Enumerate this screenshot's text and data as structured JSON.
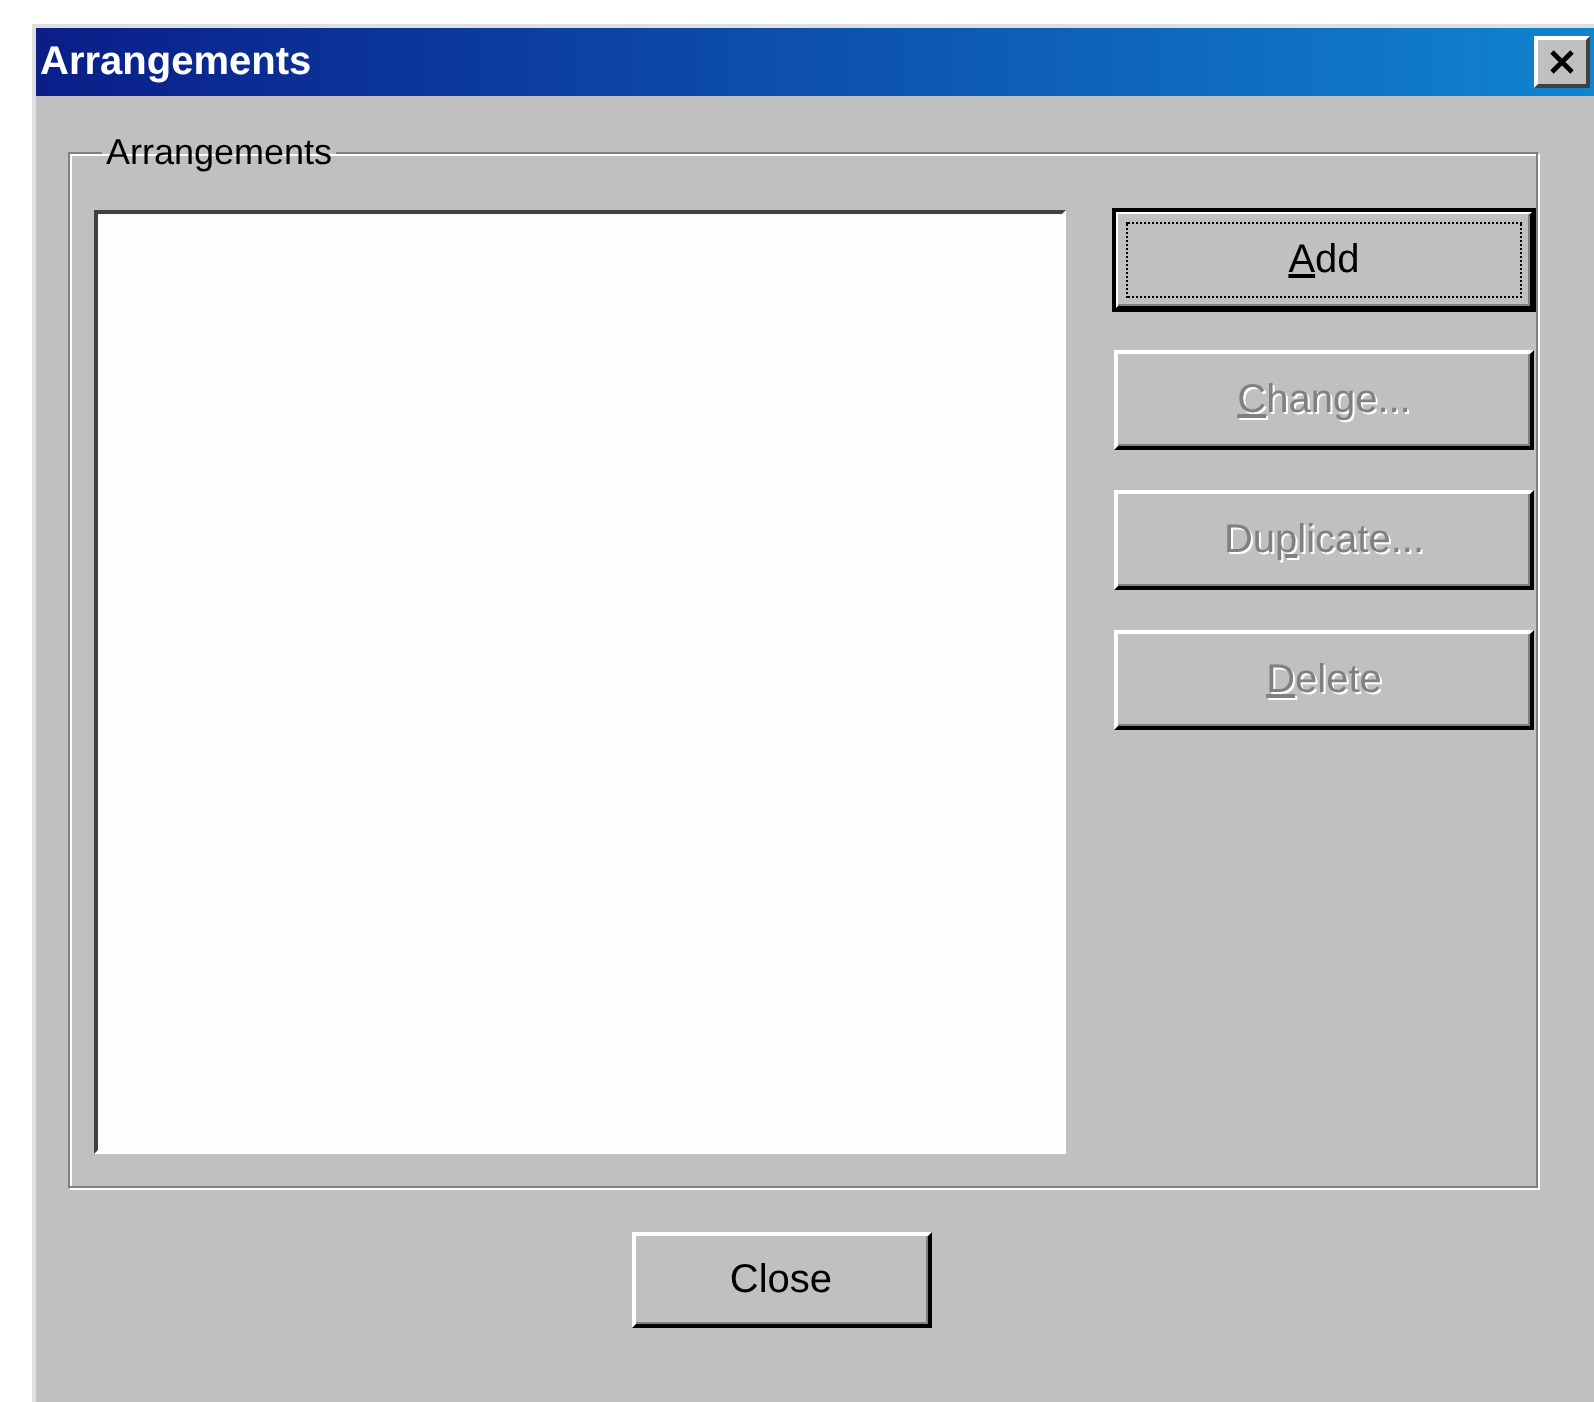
{
  "window": {
    "title": "Arrangements"
  },
  "group": {
    "label": "Arrangements"
  },
  "buttons": [
    {
      "mnemonic": "A",
      "label_rest": "dd",
      "disabled": false,
      "default": true
    },
    {
      "mnemonic": "C",
      "label_rest": "hange...",
      "disabled": true,
      "default": false
    },
    {
      "label_start": "Du",
      "mnemonic": "p",
      "label_rest": "licate...",
      "disabled": true,
      "default": false
    },
    {
      "mnemonic": "D",
      "label_rest": "elete",
      "disabled": true,
      "default": false
    }
  ],
  "close_button": {
    "label": "Close"
  }
}
